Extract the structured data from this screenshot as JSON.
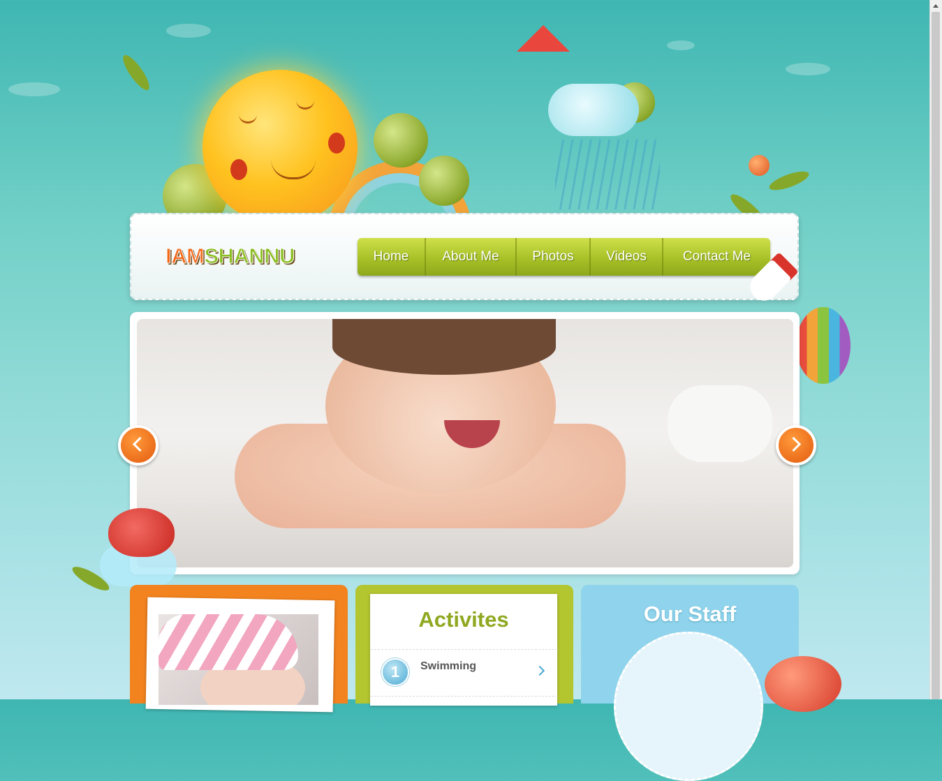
{
  "logo": {
    "part1": "IAM",
    "part2": "SHANNU"
  },
  "nav": {
    "items": [
      {
        "label": "Home"
      },
      {
        "label": "About Me"
      },
      {
        "label": "Photos"
      },
      {
        "label": "Videos"
      },
      {
        "label": "Contact Me"
      }
    ]
  },
  "slider": {
    "prev_icon": "chevron-left-icon",
    "next_icon": "chevron-right-icon"
  },
  "activities": {
    "title": "Activites",
    "items": [
      {
        "number": "1",
        "label": "Swimming"
      }
    ]
  },
  "staff": {
    "title": "Our Staff"
  },
  "colors": {
    "nav_green": "#a8c128",
    "accent_orange": "#f2831f",
    "panel_green": "#b3c52f",
    "panel_blue": "#8fd4ec",
    "activities_title": "#8fa820"
  }
}
